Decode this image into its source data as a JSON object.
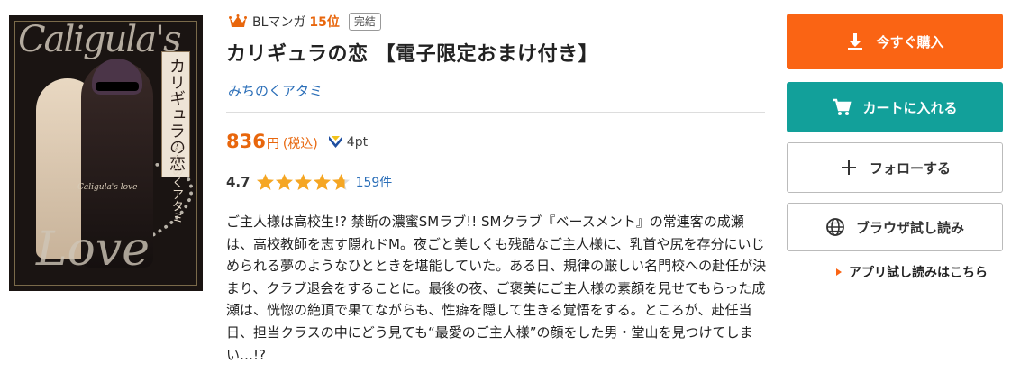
{
  "cover": {
    "script_title": "Caligula's",
    "vertical_title": "カリギュラの恋",
    "vertical_author": "みちのくアタミ",
    "subtitle": "Caligula's love",
    "script_love": "Love"
  },
  "meta": {
    "genre": "BLマンガ",
    "rank": "15位",
    "status_badge": "完結",
    "accent_color": "#e8660c"
  },
  "title": "カリギュラの恋 【電子限定おまけ付き】",
  "author": "みちのくアタミ",
  "price": {
    "amount": "836",
    "yen": "円",
    "tax": "(税込)",
    "points": "4pt"
  },
  "rating": {
    "value": "4.7",
    "stars_filled": 4.7,
    "count": "159件"
  },
  "description": "ご主人様は高校生!? 禁断の濃蜜SMラブ!! SMクラブ『ベースメント』の常連客の成瀬は、高校教師を志す隠れドM。夜ごと美しくも残酷なご主人様に、乳首や尻を存分にいじめられる夢のようなひとときを堪能していた。ある日、規律の厳しい名門校への赴任が決まり、クラブ退会をすることに。最後の夜、ご褒美にご主人様の素顔を見せてもらった成瀬は、恍惚の絶頂で果てながらも、性癖を隠して生きる覚悟をする。ところが、赴任当日、担当クラスの中にどう見ても“最愛のご主人様”の顔をした男・堂山を見つけてしまい…!?",
  "actions": {
    "buy_label": "今すぐ購入",
    "cart_label": "カートに入れる",
    "follow_label": "フォローする",
    "browser_label": "ブラウザ試し読み",
    "app_label": "アプリ試し読みはこちら",
    "buy_color": "#fa6414",
    "cart_color": "#12a09a"
  }
}
